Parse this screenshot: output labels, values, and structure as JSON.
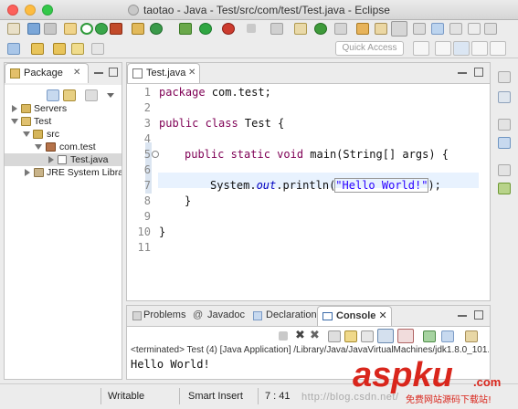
{
  "window": {
    "title": "taotao - Java - Test/src/com/test/Test.java - Eclipse"
  },
  "toolbar": {
    "quick_access_placeholder": "Quick Access"
  },
  "package_explorer": {
    "tab_label": "Package",
    "tree": [
      {
        "label": "Servers",
        "indent": 0,
        "expanded": false,
        "icon": "folder-icon"
      },
      {
        "label": "Test",
        "indent": 0,
        "expanded": true,
        "icon": "project-icon"
      },
      {
        "label": "src",
        "indent": 1,
        "expanded": true,
        "icon": "source-folder-icon"
      },
      {
        "label": "com.test",
        "indent": 2,
        "expanded": true,
        "icon": "package-icon"
      },
      {
        "label": "Test.java",
        "indent": 3,
        "expanded": false,
        "icon": "java-file-icon",
        "selected": true
      },
      {
        "label": "JRE System Librar",
        "indent": 1,
        "expanded": false,
        "icon": "library-icon"
      }
    ]
  },
  "editor": {
    "tab_label": "Test.java",
    "line_numbers": [
      "1",
      "2",
      "3",
      "4",
      "5",
      "6",
      "7",
      "8",
      "9",
      "10",
      "11"
    ],
    "lines": {
      "l1_kw": "package",
      "l1_rest": " com.test;",
      "l3_kw": "public class",
      "l3_rest": " Test {",
      "l5_kw": "public static void",
      "l5_rest": " main(String[] args) {",
      "l7_pre": "System.",
      "l7_it": "out",
      "l7_mid": ".println(",
      "l7_str": "\"Hello World!\"",
      "l7_end": ");",
      "l8": "}",
      "l10": "}"
    }
  },
  "bottom_panel": {
    "tabs": [
      "Problems",
      "Javadoc",
      "Declaration",
      "Console"
    ],
    "active_tab": "Console",
    "javadoc_prefix": "@",
    "status_line": "<terminated> Test (4) [Java Application] /Library/Java/JavaVirtualMachines/jdk1.8.0_101.",
    "output": "Hello World!"
  },
  "statusbar": {
    "writable": "Writable",
    "insert_mode": "Smart Insert",
    "position": "7 : 41",
    "watermark_url": "http://blog.csdn.net/"
  },
  "watermark": {
    "brand": "aspku",
    "domain": ".com",
    "tagline": "免费网站源码下载站!"
  },
  "colors": {
    "keyword": "#7f0055",
    "string": "#2a00ff",
    "field": "#0000c0",
    "current_line": "#e8f2fe",
    "watermark_red": "#d9261c"
  }
}
